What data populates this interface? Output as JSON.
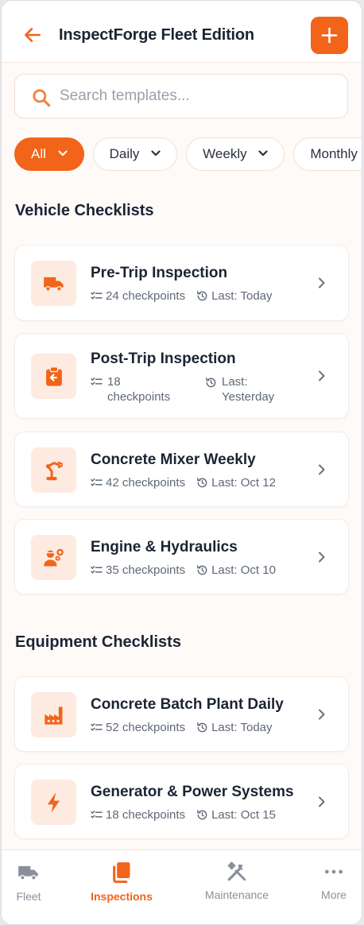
{
  "header": {
    "title": "InspectForge Fleet Edition",
    "back_icon": "arrow-left-icon",
    "add_icon": "plus-icon"
  },
  "search": {
    "placeholder": "Search templates...",
    "value": ""
  },
  "filters": [
    {
      "label": "All",
      "active": true
    },
    {
      "label": "Daily",
      "active": false
    },
    {
      "label": "Weekly",
      "active": false
    },
    {
      "label": "Monthly",
      "active": false
    }
  ],
  "sections": {
    "vehicle": {
      "title": "Vehicle Checklists",
      "items": [
        {
          "name": "Pre-Trip Inspection",
          "checkpoints": "24 checkpoints",
          "last": "Last: Today",
          "icon": "truck-icon"
        },
        {
          "name": "Post-Trip Inspection",
          "checkpoints": "18 checkpoints",
          "last": "Last: Yesterday",
          "icon": "clipboard-return-icon"
        },
        {
          "name": "Concrete Mixer Weekly",
          "checkpoints": "42 checkpoints",
          "last": "Last: Oct 12",
          "icon": "robot-arm-icon"
        },
        {
          "name": "Engine & Hydraulics",
          "checkpoints": "35 checkpoints",
          "last": "Last: Oct 10",
          "icon": "mechanic-icon"
        }
      ]
    },
    "equipment": {
      "title": "Equipment Checklists",
      "items": [
        {
          "name": "Concrete Batch Plant Daily",
          "checkpoints": "52 checkpoints",
          "last": "Last: Today",
          "icon": "factory-icon"
        },
        {
          "name": "Generator & Power Systems",
          "checkpoints": "18 checkpoints",
          "last": "Last: Oct 15",
          "icon": "lightning-icon"
        }
      ]
    }
  },
  "nav": [
    {
      "label": "Fleet",
      "icon": "truck-icon",
      "active": false
    },
    {
      "label": "Inspections",
      "icon": "copy-icon",
      "active": true
    },
    {
      "label": "Maintenance",
      "icon": "tools-icon",
      "active": false
    },
    {
      "label": "More",
      "icon": "more-icon",
      "active": false
    }
  ],
  "colors": {
    "accent": "#f26419",
    "accent_soft": "#fdebe1",
    "text": "#1c2433",
    "muted": "#5f6878"
  }
}
